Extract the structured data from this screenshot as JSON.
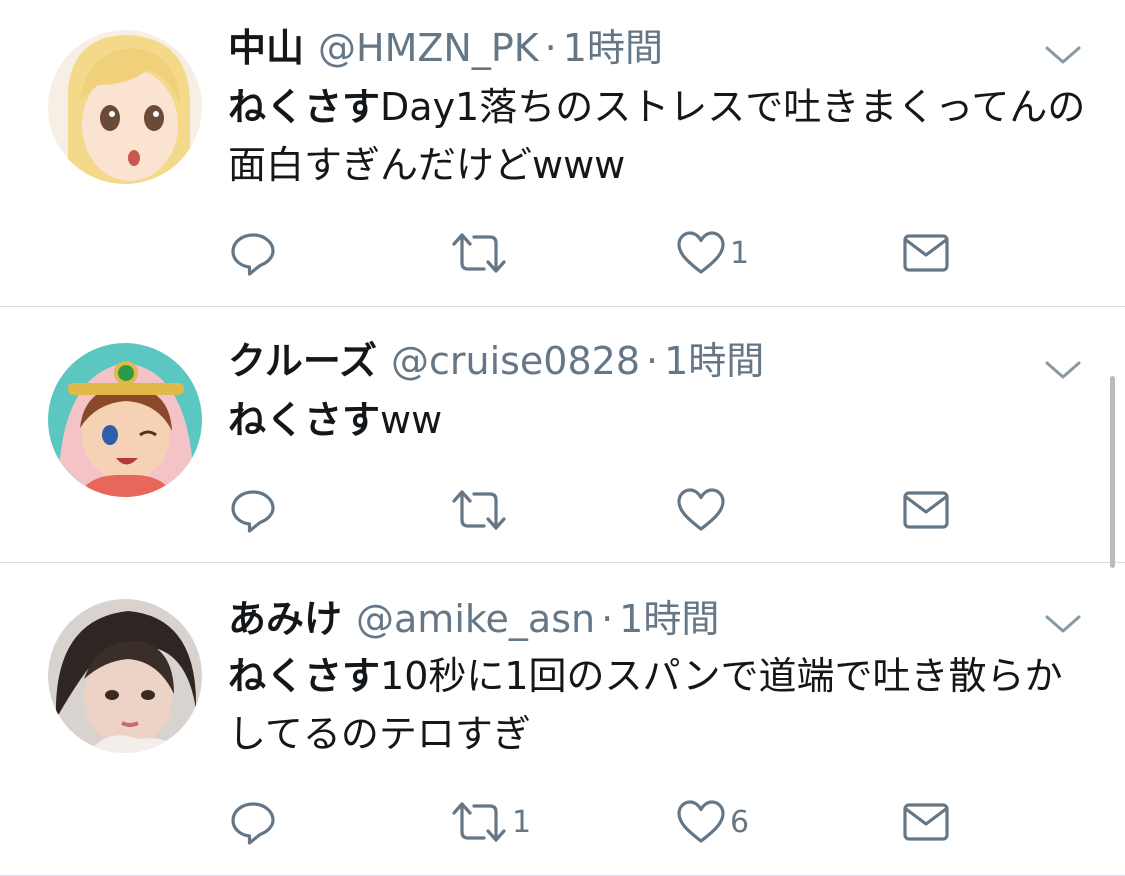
{
  "colors": {
    "text": "#14171a",
    "secondary": "#657786",
    "divider": "#d8dee3",
    "icon": "#657786"
  },
  "tweets": [
    {
      "avatar": "anime-girl-blonde-avatar",
      "name": "中山",
      "handle": "@HMZN_PK",
      "separator": "·",
      "time": "1時間",
      "mention": "ねくさす",
      "text": "Day1落ちのストレスで吐きまくってんの面白すぎんだけどwww",
      "reply_count": "",
      "retweet_count": "",
      "like_count": "1"
    },
    {
      "avatar": "anime-girl-pink-hood-avatar",
      "name": "クルーズ",
      "handle": "@cruise0828",
      "separator": "·",
      "time": "1時間",
      "mention": "ねくさす",
      "text": "ww",
      "reply_count": "",
      "retweet_count": "",
      "like_count": ""
    },
    {
      "avatar": "photo-girl-dark-hair-avatar",
      "name": "あみけ",
      "handle": "@amike_asn",
      "separator": "·",
      "time": "1時間",
      "mention": "ねくさす",
      "text": "10秒に1回のスパンで道端で吐き散らかしてるのテロすぎ",
      "reply_count": "",
      "retweet_count": "1",
      "like_count": "6"
    }
  ]
}
